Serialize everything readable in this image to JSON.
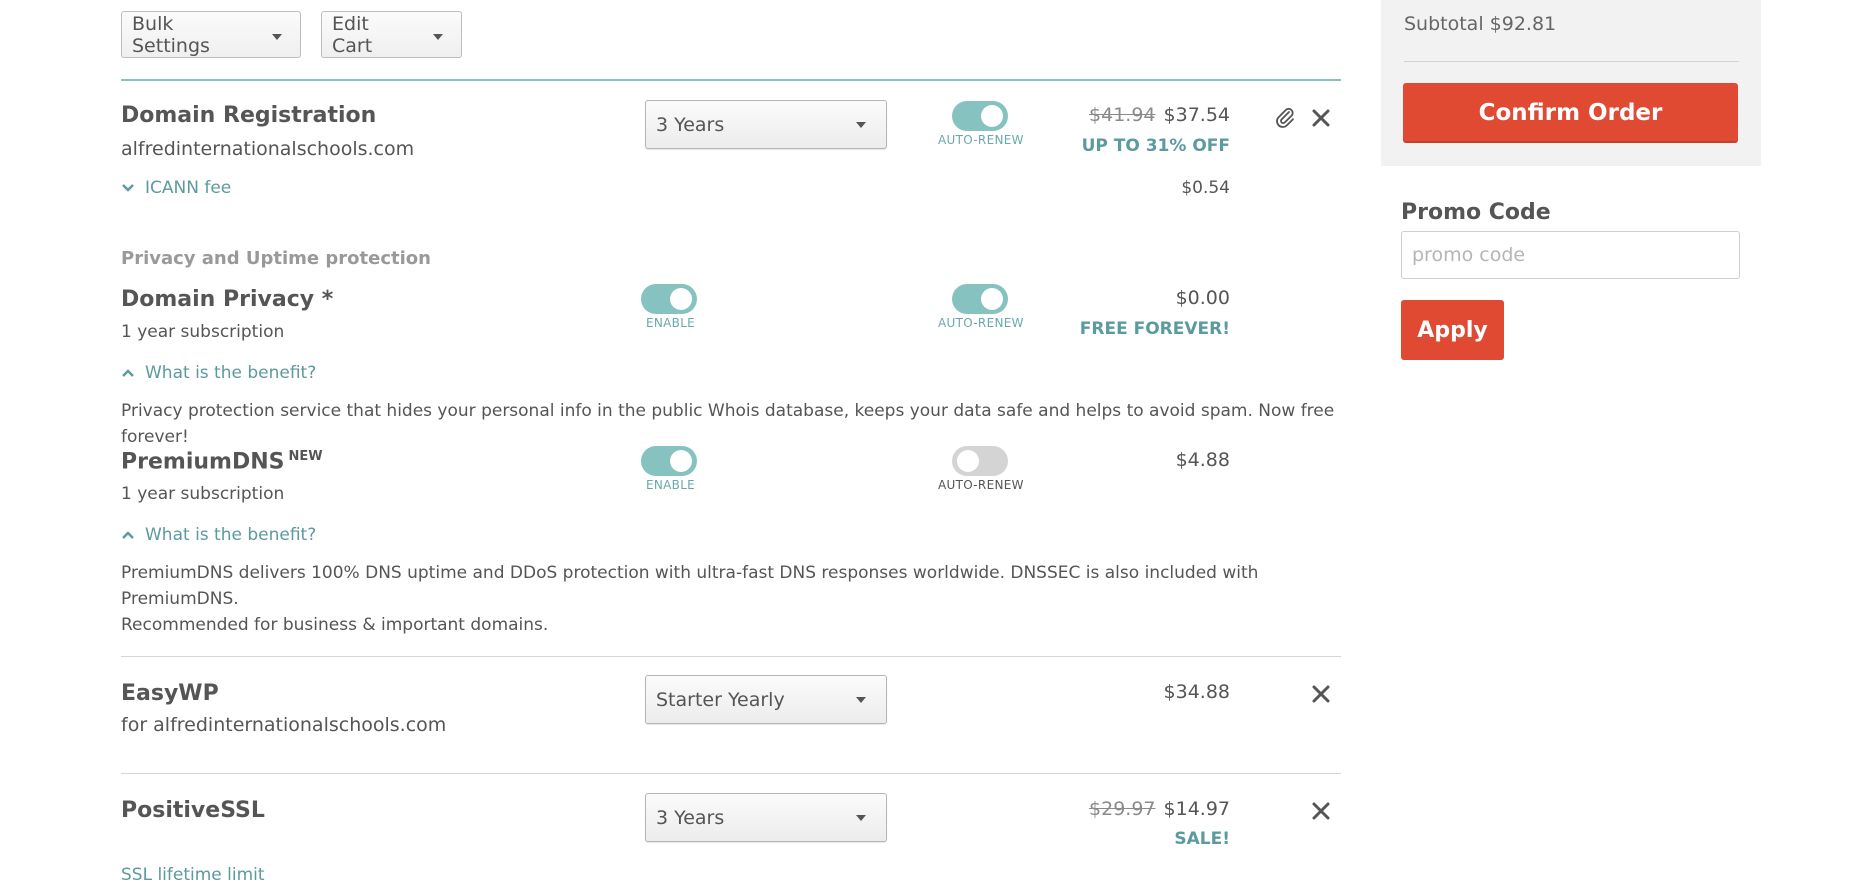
{
  "toolbar": {
    "bulk_settings": "Bulk Settings",
    "edit_cart": "Edit Cart"
  },
  "domain_registration": {
    "title": "Domain Registration",
    "domain": "alfredinternationalschools.com",
    "term": "3 Years",
    "auto_renew_label": "AUTO-RENEW",
    "auto_renew_on": true,
    "old_price": "$41.94",
    "price": "$37.54",
    "deal": "UP TO 31% OFF",
    "icann_label": "ICANN fee",
    "icann_price": "$0.54"
  },
  "privacy_section": {
    "heading": "Privacy and Uptime protection",
    "domain_privacy": {
      "title": "Domain Privacy *",
      "subtitle": "1 year subscription",
      "enable_label": "ENABLE",
      "auto_renew_label": "AUTO-RENEW",
      "price": "$0.00",
      "deal": "FREE FOREVER!",
      "benefit_link": "What is the benefit?",
      "description": "Privacy protection service that hides your personal info in the public Whois database, keeps your data safe and helps to avoid spam. Now free forever!"
    },
    "premium_dns": {
      "title": "PremiumDNS",
      "badge": "NEW",
      "subtitle": "1 year subscription",
      "enable_label": "ENABLE",
      "auto_renew_label": "AUTO-RENEW",
      "price": "$4.88",
      "benefit_link": "What is the benefit?",
      "description_line1": "PremiumDNS delivers 100% DNS uptime and DDoS protection with ultra-fast DNS responses worldwide. DNSSEC is also included with PremiumDNS.",
      "description_line2": "Recommended for business & important domains."
    }
  },
  "easywp": {
    "title": "EasyWP",
    "subtitle": "for alfredinternationalschools.com",
    "plan": "Starter Yearly",
    "price": "$34.88"
  },
  "positivessl": {
    "title": "PositiveSSL",
    "term": "3 Years",
    "old_price": "$29.97",
    "price": "$14.97",
    "deal": "SALE!",
    "lifetime_link": "SSL lifetime limit"
  },
  "summary": {
    "subtotal": "Subtotal $92.81",
    "confirm_label": "Confirm Order",
    "promo_label": "Promo Code",
    "promo_placeholder": "promo code",
    "apply_label": "Apply"
  },
  "colors": {
    "teal": "#86c3c0",
    "link_teal": "#5b9a9f",
    "orange": "#e04a33",
    "panel": "#f2f2f2"
  }
}
